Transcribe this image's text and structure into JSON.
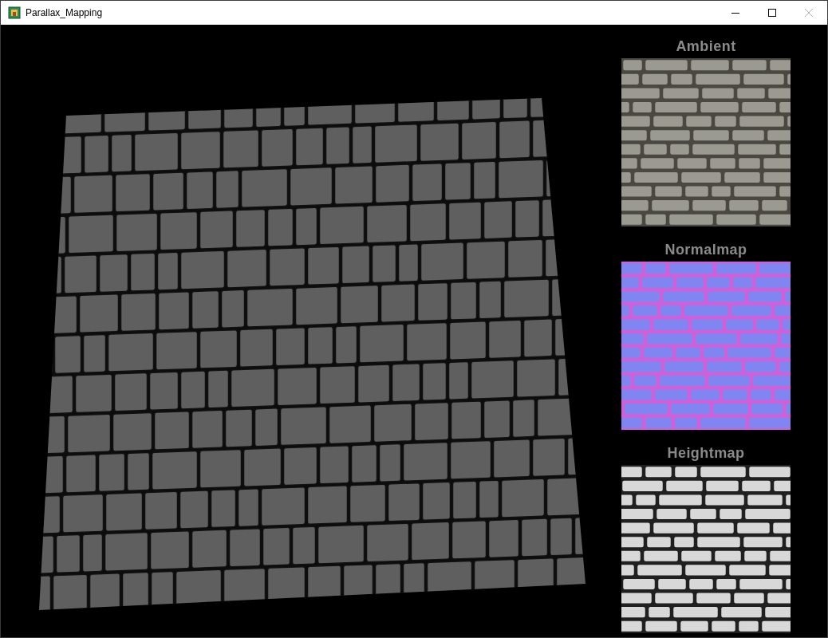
{
  "window": {
    "title": "Parallax_Mapping"
  },
  "texture_panels": [
    {
      "label": "Ambient",
      "kind": "ambient"
    },
    {
      "label": "Normalmap",
      "kind": "normal"
    },
    {
      "label": "Heightmap",
      "kind": "height"
    }
  ]
}
